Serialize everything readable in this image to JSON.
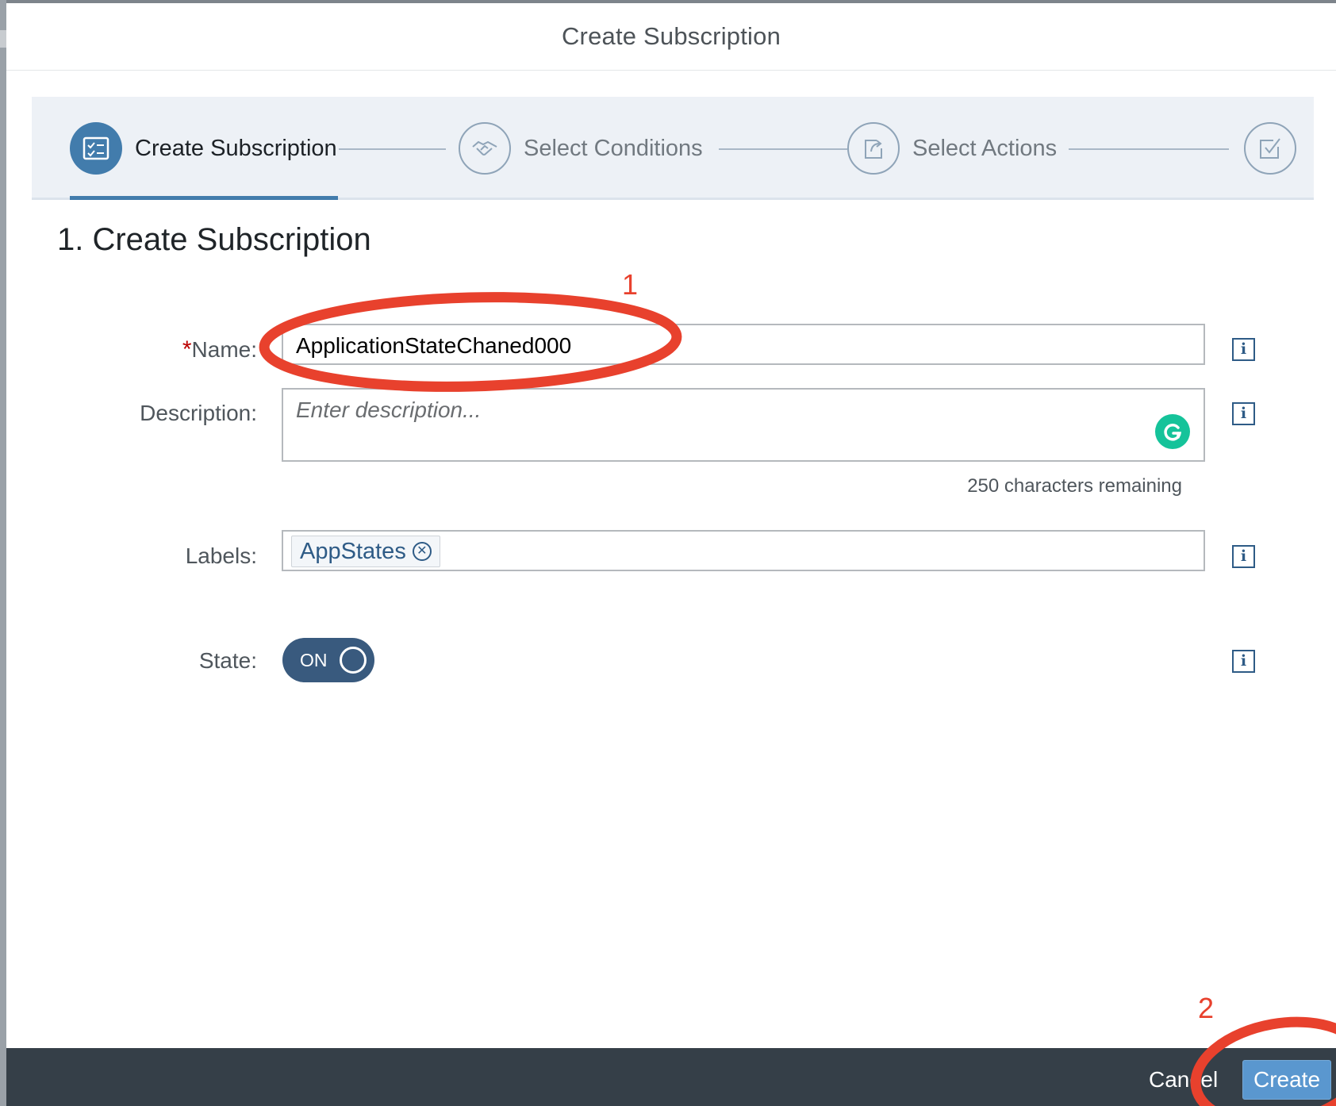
{
  "dialog": {
    "title": "Create Subscription"
  },
  "wizard": {
    "steps": [
      {
        "label": "Create Subscription",
        "icon": "checklist-icon",
        "state": "active"
      },
      {
        "label": "Select Conditions",
        "icon": "handshake-icon",
        "state": "inactive"
      },
      {
        "label": "Select Actions",
        "icon": "share-icon",
        "state": "inactive"
      },
      {
        "label": "",
        "icon": "checkbox-icon",
        "state": "inactive"
      }
    ]
  },
  "section": {
    "title": "1. Create Subscription"
  },
  "form": {
    "name": {
      "required_mark": "*",
      "label": "Name:",
      "value": "ApplicationStateChaned000"
    },
    "description": {
      "label": "Description:",
      "placeholder": "Enter description...",
      "counter": "250 characters remaining"
    },
    "labels": {
      "label": "Labels:",
      "tokens": [
        "AppStates"
      ]
    },
    "state": {
      "label": "State:",
      "toggle_text": "ON",
      "value": true
    }
  },
  "footer": {
    "cancel_label": "Cancel",
    "create_label": "Create"
  },
  "annotations": {
    "marker_1": "1",
    "marker_2": "2",
    "color": "#e8412d"
  },
  "colors": {
    "accent": "#427cac",
    "footer_bg": "#353f48",
    "create_button": "#5a97cf",
    "grammarly": "#15c39a"
  }
}
